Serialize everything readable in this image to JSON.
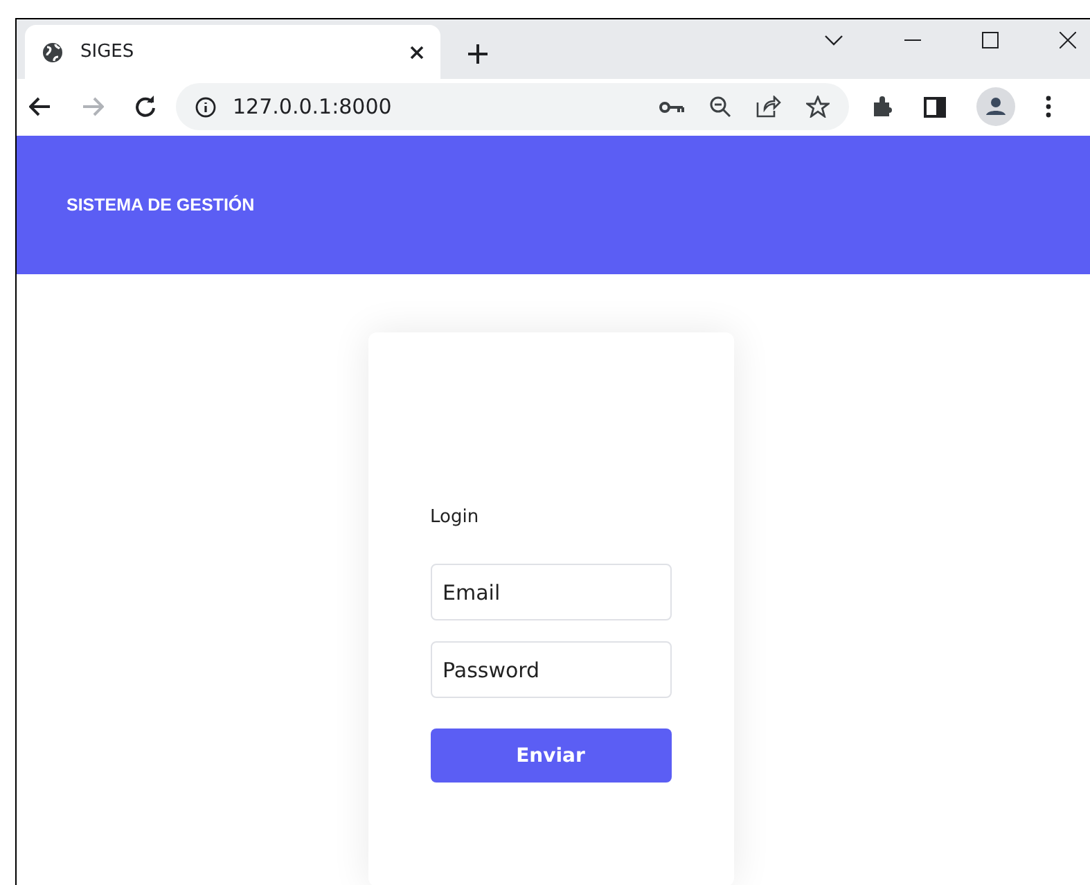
{
  "browser": {
    "tab": {
      "title": "SIGES"
    },
    "address": "127.0.0.1:8000"
  },
  "header": {
    "brand": "SISTEMA DE GESTIÓN"
  },
  "login": {
    "title": "Login",
    "fields": [
      {
        "placeholder": "Email"
      },
      {
        "placeholder": "Password"
      }
    ],
    "button": "Enviar"
  }
}
